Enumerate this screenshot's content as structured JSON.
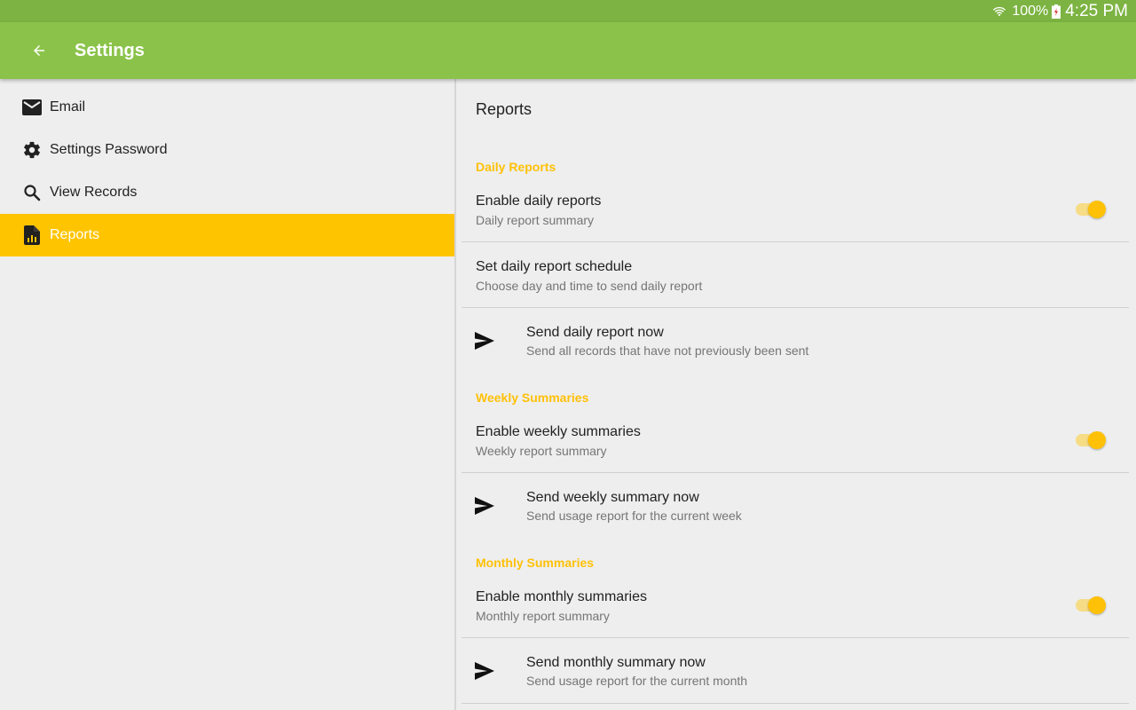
{
  "status_bar": {
    "battery_percent": "100%",
    "time": "4:25 PM",
    "icons": [
      "wifi-icon",
      "battery-charging-icon"
    ]
  },
  "app_bar": {
    "title": "Settings",
    "back_icon": "arrow-back-icon"
  },
  "sidebar": {
    "items": [
      {
        "label": "Email",
        "icon": "mail-icon",
        "active": false
      },
      {
        "label": "Settings Password",
        "icon": "gear-icon",
        "active": false
      },
      {
        "label": "View Records",
        "icon": "search-icon",
        "active": false
      },
      {
        "label": "Reports",
        "icon": "report-document-icon",
        "active": true
      }
    ]
  },
  "main": {
    "title": "Reports",
    "sections": [
      {
        "header": "Daily Reports",
        "prefs": [
          {
            "title": "Enable daily reports",
            "summary": "Daily report summary",
            "toggle": true
          },
          {
            "title": "Set daily report schedule",
            "summary": "Choose day and time to send daily report"
          },
          {
            "title": "Send daily report now",
            "summary": "Send all records that have not previously been sent",
            "icon": "send-icon"
          }
        ]
      },
      {
        "header": "Weekly Summaries",
        "prefs": [
          {
            "title": "Enable weekly summaries",
            "summary": "Weekly report summary",
            "toggle": true
          },
          {
            "title": "Send weekly summary now",
            "summary": "Send usage report for the current week",
            "icon": "send-icon"
          }
        ]
      },
      {
        "header": "Monthly Summaries",
        "prefs": [
          {
            "title": "Enable monthly summaries",
            "summary": "Monthly report summary",
            "toggle": true
          },
          {
            "title": "Send monthly summary now",
            "summary": "Send usage report for the current month",
            "icon": "send-icon"
          }
        ]
      }
    ]
  },
  "colors": {
    "status_bar": "#7cb342",
    "app_bar": "#8bc34a",
    "accent": "#ffc107",
    "active_nav": "#ffc400"
  }
}
